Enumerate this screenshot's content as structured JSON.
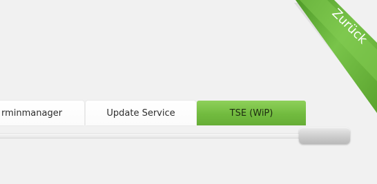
{
  "tabs": [
    {
      "label": "rminmanager"
    },
    {
      "label": "Update Service"
    },
    {
      "label": "TSE (WiP)",
      "active": true
    }
  ],
  "corner_ribbon": {
    "label": "Zurück",
    "color": "#6cba3a"
  },
  "colors": {
    "background": "#f1f1f1",
    "active_tab": "#72bb3f",
    "inactive_tab": "#ffffff"
  }
}
